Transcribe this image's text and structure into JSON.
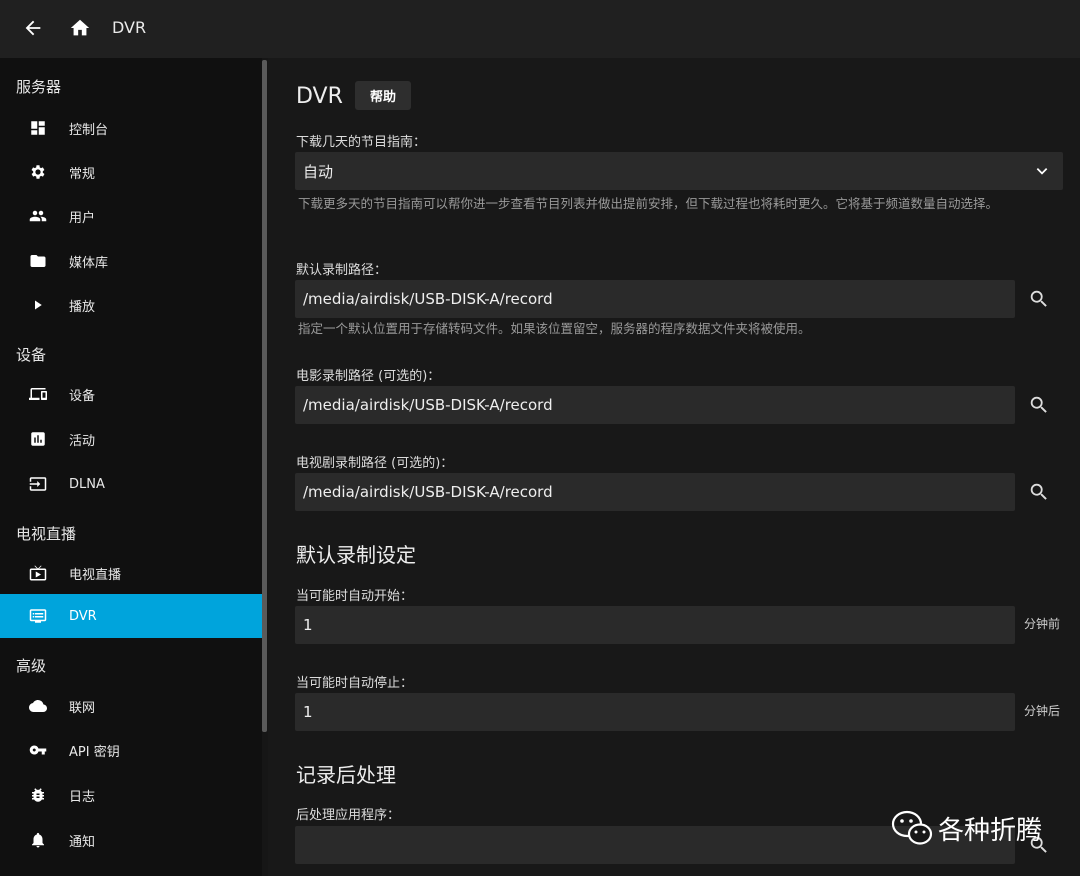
{
  "header": {
    "title": "DVR"
  },
  "sidebar": {
    "sections": [
      {
        "title": "服务器",
        "items": [
          "控制台",
          "常规",
          "用户",
          "媒体库",
          "播放"
        ]
      },
      {
        "title": "设备",
        "items": [
          "设备",
          "活动",
          "DLNA"
        ]
      },
      {
        "title": "电视直播",
        "items": [
          "电视直播",
          "DVR"
        ]
      },
      {
        "title": "高级",
        "items": [
          "联网",
          "API 密钥",
          "日志",
          "通知"
        ]
      }
    ],
    "active_item": "DVR"
  },
  "main": {
    "title": "DVR",
    "help_label": "帮助",
    "guide_days": {
      "label": "下载几天的节目指南：",
      "value": "自动",
      "hint": "下载更多天的节目指南可以帮你进一步查看节目列表并做出提前安排，但下载过程也将耗时更久。它将基于频道数量自动选择。"
    },
    "default_path": {
      "label": "默认录制路径：",
      "value": "/media/airdisk/USB-DISK-A/record",
      "hint": "指定一个默认位置用于存储转码文件。如果该位置留空，服务器的程序数据文件夹将被使用。"
    },
    "movie_path": {
      "label": "电影录制路径 (可选的)：",
      "value": "/media/airdisk/USB-DISK-A/record"
    },
    "series_path": {
      "label": "电视剧录制路径 (可选的)：",
      "value": "/media/airdisk/USB-DISK-A/record"
    },
    "default_settings_heading": "默认录制设定",
    "pre_padding": {
      "label": "当可能时自动开始：",
      "value": "1",
      "unit": "分钟前"
    },
    "post_padding": {
      "label": "当可能时自动停止：",
      "value": "1",
      "unit": "分钟后"
    },
    "post_processing_heading": "记录后处理",
    "post_processor": {
      "label": "后处理应用程序：",
      "value": ""
    }
  },
  "watermark": {
    "text": "各种折腾"
  },
  "colors": {
    "accent": "#00a4dc",
    "header_bg": "#202020",
    "field_bg": "#2a2a2a"
  }
}
